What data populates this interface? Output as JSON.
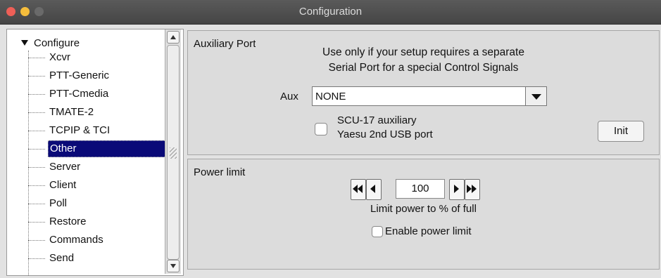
{
  "window": {
    "title": "Configuration"
  },
  "tree": {
    "root": "Configure",
    "items": [
      "Xcvr",
      "PTT-Generic",
      "PTT-Cmedia",
      "TMATE-2",
      "TCPIP & TCI",
      "Other",
      "Server",
      "Client",
      "Poll",
      "Restore",
      "Commands",
      "Send"
    ],
    "selected": "Other"
  },
  "aux": {
    "group_label": "Auxiliary Port",
    "description_line1": "Use only if your setup requires a separate",
    "description_line2": "Serial Port for a special Control Signals",
    "field_label": "Aux",
    "value": "NONE",
    "checkbox_line1": "SCU-17 auxiliary",
    "checkbox_line2": "Yaesu 2nd USB port",
    "checkbox_checked": false,
    "init_button": "Init"
  },
  "power": {
    "group_label": "Power limit",
    "value": "100",
    "note": "Limit power to % of full",
    "enable_label": "Enable power limit",
    "enable_checked": false
  }
}
